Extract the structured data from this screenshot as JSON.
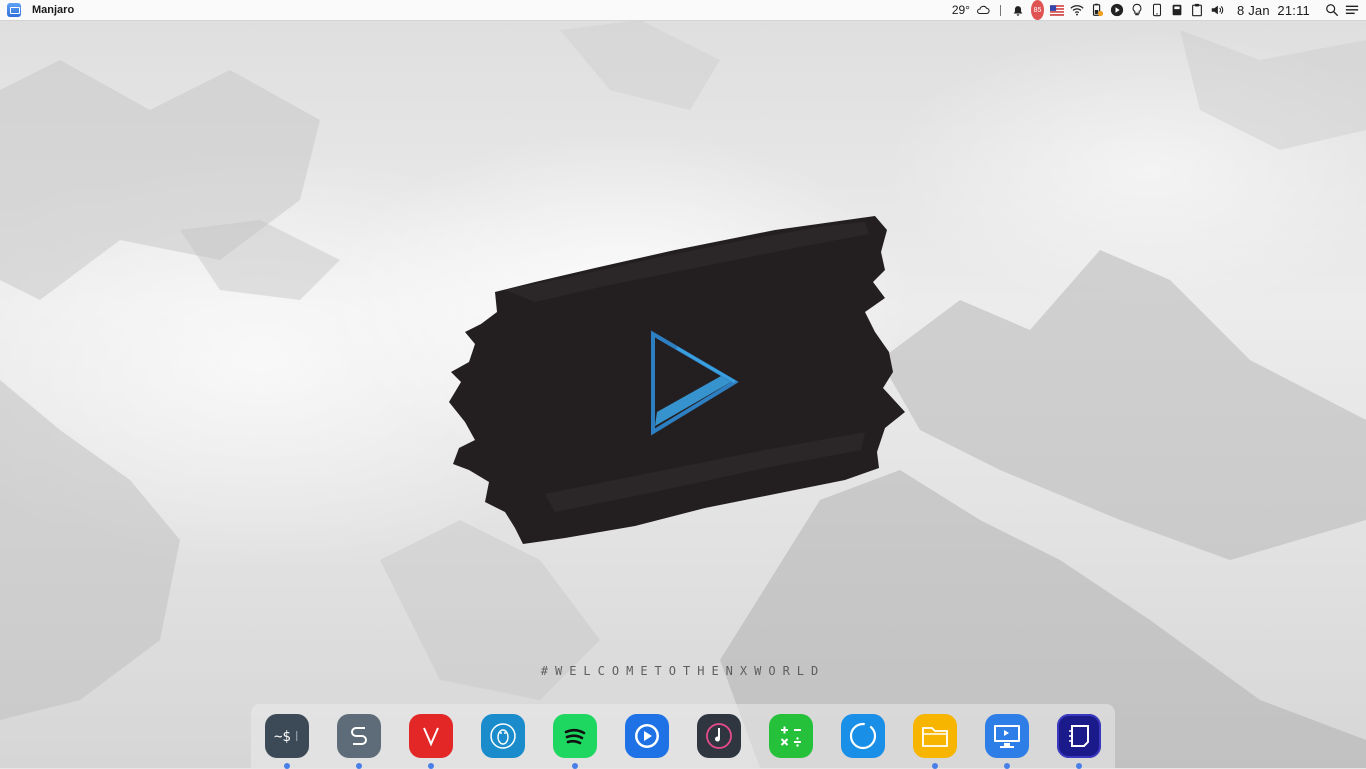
{
  "panel": {
    "app_name": "Manjaro",
    "temperature": "29°",
    "notification_count": "85",
    "date": "8 Jan",
    "time": "21:11",
    "tray_icons": [
      "weather-cloud-icon",
      "bell-icon",
      "notification-badge",
      "us-flag-icon",
      "wifi-icon",
      "battery-icon",
      "play-icon",
      "bulb-icon",
      "phone-icon",
      "drive-icon",
      "clipboard-icon",
      "volume-icon"
    ],
    "right_icons": [
      "search-icon",
      "menu-icon"
    ]
  },
  "desktop": {
    "welcome_text": "#WELCOMETOTHENXWORLD",
    "logo": "nx-play-logo"
  },
  "dock": {
    "items": [
      {
        "name": "terminal",
        "icon": "terminal-icon",
        "running": true
      },
      {
        "name": "simplenote",
        "icon": "s-letter-icon",
        "running": true
      },
      {
        "name": "vivaldi",
        "icon": "vivaldi-icon",
        "running": true
      },
      {
        "name": "linux-app",
        "icon": "tux-icon",
        "running": false
      },
      {
        "name": "spotify",
        "icon": "spotify-icon",
        "running": true
      },
      {
        "name": "media-player",
        "icon": "play-circle-icon",
        "running": false
      },
      {
        "name": "music",
        "icon": "music-note-icon",
        "running": false
      },
      {
        "name": "calculator",
        "icon": "calculator-icon",
        "running": false
      },
      {
        "name": "settings",
        "icon": "ring-icon",
        "running": false
      },
      {
        "name": "files",
        "icon": "folder-icon",
        "running": true
      },
      {
        "name": "remote-desktop",
        "icon": "monitor-icon",
        "running": true
      },
      {
        "name": "notes",
        "icon": "note-icon",
        "running": true
      }
    ],
    "colors": {
      "terminal": "#3c4a57",
      "simplenote": "#5e6c79",
      "vivaldi": "#e32727",
      "linux-app": "#1a8ccc",
      "spotify": "#1ed760",
      "media-player": "#1e72e6",
      "music": "#2f3640",
      "calculator": "#26c13b",
      "settings": "#1a8fe8",
      "files": "#f7b500",
      "remote-desktop": "#2d7ee6",
      "notes": "#1b1a8a"
    }
  },
  "theme": {
    "accent": "#4a7fe8",
    "panel_bg": "#fafafa",
    "logo_blue": "#3aa0e0"
  }
}
